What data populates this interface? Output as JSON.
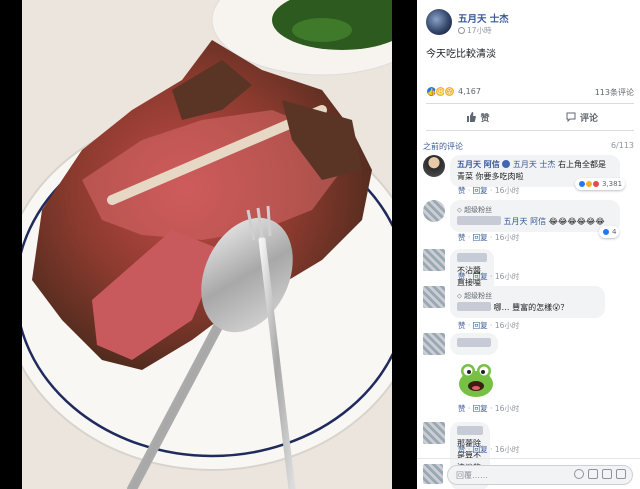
{
  "post": {
    "author": "五月天 士杰",
    "time": "17小時",
    "text": "今天吃比較清淡",
    "reaction_count": "4,167",
    "comment_count": "113条评论",
    "like_label": "赞",
    "comment_label": "评论"
  },
  "comments_header": {
    "previous": "之前的评论",
    "pager": "6/113"
  },
  "comments": [
    {
      "author": "五月天 阿信",
      "mention": "五月天 士杰",
      "text": "右上角全都是青菜 你要多吃肉啦",
      "like": "赞",
      "reply": "回复",
      "time": "16小时",
      "reaction_count": "3,381"
    },
    {
      "badge": "超级粉丝",
      "mention": "五月天 阿信",
      "text": "😂😂😂😂😂😂",
      "like": "赞",
      "reply": "回复",
      "time": "16小时",
      "reaction_count": "4"
    },
    {
      "text": "不沾醬直接嗑 清淡",
      "like": "赞",
      "reply": "回复",
      "time": "16小时"
    },
    {
      "badge": "超级粉丝",
      "text": "哪… 豐富的怎樣😮？",
      "like": "赞",
      "reply": "回复",
      "time": "16小时"
    },
    {
      "like": "赞",
      "reply": "回复",
      "time": "16小时"
    },
    {
      "text": "那藿除是算不清淡的嗎？",
      "like": "赞",
      "reply": "回复",
      "time": "16小时"
    }
  ],
  "composer": {
    "placeholder": "回覆……"
  },
  "colors": {
    "link": "#385898",
    "like_blue": "#2078f4",
    "bubble": "#f2f3f5"
  }
}
